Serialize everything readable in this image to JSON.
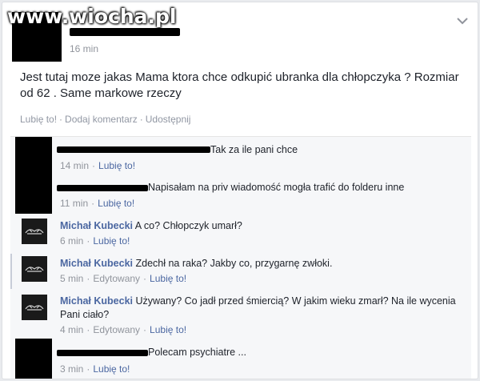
{
  "watermark": "www.wiocha.pl",
  "post": {
    "time": "16 min",
    "text": "Jest tutaj moze jakas Mama ktora chce odkupić ubranka dla chłopczyka ? Rozmiar od 62 . Same markowe rzeczy",
    "actions": {
      "like": "Lubię to!",
      "comment": "Dodaj komentarz",
      "share": "Udostępnij",
      "separator": "·"
    }
  },
  "comments": [
    {
      "author": "",
      "text": "Tak za ile pani chce",
      "time": "14 min",
      "like": "Lubię to!"
    },
    {
      "author": "",
      "text": "Napisałam na priv wiadomość mogła trafić do folderu inne",
      "time": "11 min",
      "like": "Lubię to!"
    },
    {
      "author": "Michał Kubecki",
      "text": "A co? Chłopczyk umarł?",
      "time": "6 min",
      "like": "Lubię to!"
    },
    {
      "author": "Michał Kubecki",
      "text": "Zdechł na raka? Jakby co, przygarnę zwłoki.",
      "time": "5 min",
      "edited": "Edytowany",
      "like": "Lubię to!"
    },
    {
      "author": "Michał Kubecki",
      "text": "Używany? Co jadł przed śmiercią? W jakim wieku zmarł? Na ile wycenia Pani ciało?",
      "time": "4 min",
      "edited": "Edytowany",
      "like": "Lubię to!"
    },
    {
      "author": "",
      "text": "Polecam psychiatre ...",
      "time": "3 min",
      "like": "Lubię to!"
    }
  ],
  "colors": {
    "link": "#4b67a1",
    "meta": "#90949c",
    "text": "#1d2129",
    "background": "#e9ebee"
  },
  "icons": {
    "menu": "chevron-down-icon",
    "avatar_logo": "wing-logo-icon"
  }
}
